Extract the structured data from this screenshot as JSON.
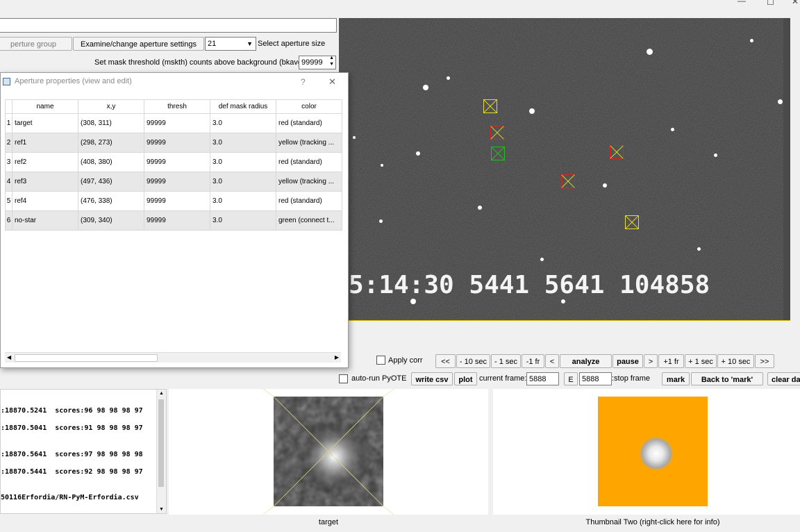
{
  "top_controls": {
    "aperture_group_label": "perture group",
    "examine_button": "Examine/change aperture settings",
    "aperture_size_value": "21",
    "aperture_size_label": "Select aperture size",
    "mask_threshold_label": "Set mask threshold (mskth) counts above background (bkavg)",
    "mask_threshold_value": "99999"
  },
  "dialog": {
    "title": "Aperture properties (view and edit)",
    "help_symbol": "?",
    "close_symbol": "✕",
    "columns": [
      "name",
      "x,y",
      "thresh",
      "def mask radius",
      "color"
    ],
    "rows": [
      {
        "num": "1",
        "name": "target",
        "xy": "(308, 311)",
        "thresh": "99999",
        "radius": "3.0",
        "color": "red (standard)"
      },
      {
        "num": "2",
        "name": "ref1",
        "xy": "(298, 273)",
        "thresh": "99999",
        "radius": "3.0",
        "color": "yellow (tracking ..."
      },
      {
        "num": "3",
        "name": "ref2",
        "xy": "(408, 380)",
        "thresh": "99999",
        "radius": "3.0",
        "color": "red (standard)"
      },
      {
        "num": "4",
        "name": "ref3",
        "xy": "(497, 436)",
        "thresh": "99999",
        "radius": "3.0",
        "color": "yellow (tracking ..."
      },
      {
        "num": "5",
        "name": "ref4",
        "xy": "(476, 338)",
        "thresh": "99999",
        "radius": "3.0",
        "color": "red (standard)"
      },
      {
        "num": "6",
        "name": "no-star",
        "xy": "(309, 340)",
        "thresh": "99999",
        "radius": "3.0",
        "color": "green (connect t..."
      }
    ]
  },
  "image_view": {
    "timestamp_overlay": "5:14:30 5441 5641 104858"
  },
  "playback": {
    "apply_corr_label": "Apply corr",
    "buttons": [
      "<<",
      "- 10 sec",
      "- 1 sec",
      "-1 fr",
      "<",
      "analyze",
      "pause",
      ">",
      "+1 fr",
      "+ 1 sec",
      "+ 10 sec",
      ">>"
    ]
  },
  "frame_row": {
    "autorun_label": "auto-run PyOTE",
    "write_csv": "write csv",
    "plot": "plot",
    "current_frame_label": "current frame:",
    "current_frame_value": "5888",
    "e_button": "E",
    "stop_frame_value": "5888",
    "stop_frame_label": ":stop frame",
    "mark": "mark",
    "back_to_mark": "Back to 'mark'",
    "clear": "clear da"
  },
  "log": {
    "lines": [
      ":18870.5241  scores:96 98 98 98 97",
      ":18870.5041  scores:91 98 98 98 97",
      ":18870.5641  scores:97 98 98 98 98",
      ":18870.5441  scores:92 98 98 98 97",
      "50116Erfordia/RN-PyM-Erfordia.csv"
    ]
  },
  "thumbnails": {
    "one_caption": "target",
    "two_caption": "Thumbnail Two (right-click here for info)",
    "two_background": "#ffa500"
  }
}
